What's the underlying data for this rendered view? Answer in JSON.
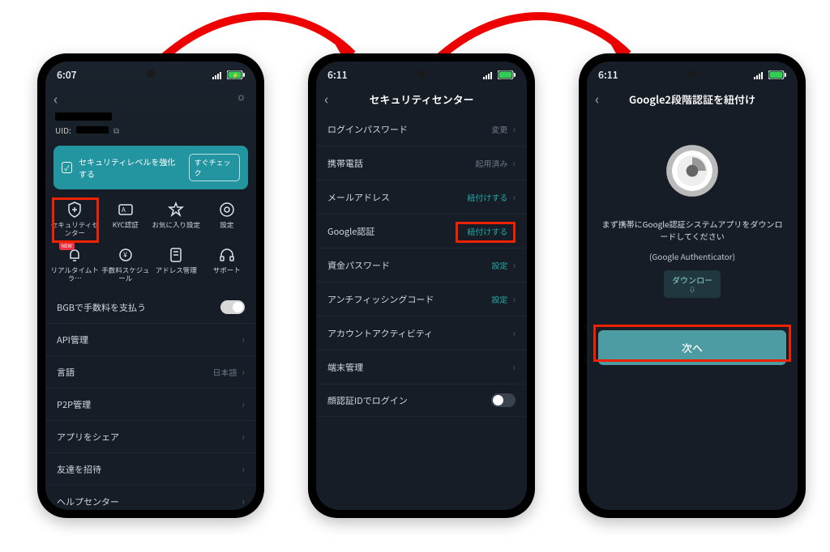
{
  "phone1": {
    "time": "6:07",
    "uid_label": "UID:",
    "banner_text": "セキュリティレベルを強化する",
    "banner_cta": "すぐチェック",
    "grid": [
      {
        "label": "セキュリティセンター"
      },
      {
        "label": "KYC認証"
      },
      {
        "label": "お気に入り設定"
      },
      {
        "label": "設定"
      },
      {
        "label": "リアルタイムトラ…",
        "badge": "NEW"
      },
      {
        "label": "手数料スケジュール"
      },
      {
        "label": "アドレス管理"
      },
      {
        "label": "サポート"
      }
    ],
    "rows": {
      "bgb": "BGBで手数料を支払う",
      "api": "API管理",
      "lang": "言語",
      "lang_value": "日本語",
      "p2p": "P2P管理",
      "share": "アプリをシェア",
      "invite": "友達を招待",
      "help": "ヘルプセンター"
    }
  },
  "phone2": {
    "time": "6:11",
    "title": "セキュリティセンター",
    "items": [
      {
        "label": "ログインパスワード",
        "value": "変更",
        "teal": false
      },
      {
        "label": "携帯電話",
        "value": "起用済み",
        "teal": false
      },
      {
        "label": "メールアドレス",
        "value": "紐付けする",
        "teal": true
      },
      {
        "label": "Google認証",
        "value": "紐付けする",
        "teal": true
      },
      {
        "label": "資金パスワード",
        "value": "設定",
        "teal": true
      },
      {
        "label": "アンチフィッシングコード",
        "value": "設定",
        "teal": true
      },
      {
        "label": "アカウントアクティビティ",
        "value": "",
        "teal": false
      },
      {
        "label": "端末管理",
        "value": "",
        "teal": false
      }
    ],
    "faceid": "顔認証IDでログイン"
  },
  "phone3": {
    "time": "6:11",
    "title": "Google2段階認証を紐付け",
    "desc": "まず携帯にGoogle認証システムアプリをダウンロードしてください",
    "sub": "(Google Authenticator)",
    "download": "ダウンロー",
    "next": "次へ"
  }
}
